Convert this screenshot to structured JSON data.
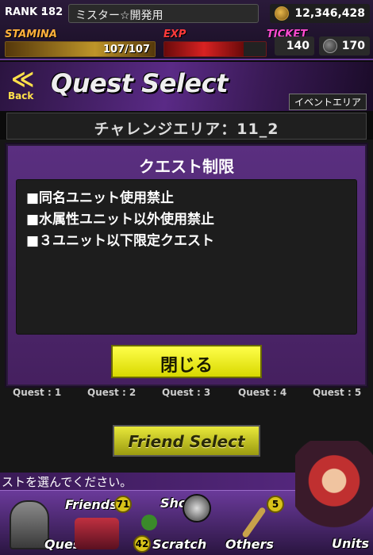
{
  "status": {
    "rank_label": "RANK :",
    "rank_value": "182",
    "player_name": "ミスター☆開発用",
    "gold": "12,346,428",
    "stamina_label": "STAMINA",
    "stamina_value": "107/107",
    "stamina_fraction": 1.0,
    "exp_label": "EXP",
    "exp_fraction": 0.78,
    "ticket_label": "TICKET",
    "ticket_value": "140",
    "gem_value": "170"
  },
  "header": {
    "back_label": "Back",
    "back_glyph": "≪",
    "title": "Quest Select",
    "event_tag": "イベントエリア"
  },
  "area": {
    "name": "チャレンジエリア：11_2"
  },
  "modal": {
    "title": "クエスト制限",
    "rules": [
      "■同名ユニット使用禁止",
      "■水属性ユニット以外使用禁止",
      "■３ユニット以下限定クエスト"
    ],
    "close_label": "閉じる"
  },
  "quest_tabs": [
    "Quest : 1",
    "Quest : 2",
    "Quest : 3",
    "Quest : 4",
    "Quest : 5"
  ],
  "friend_select_label": "Friend Select",
  "hint_text": "ストを選んでください。",
  "nav": {
    "quest": "Quest",
    "friends": "Friends",
    "friends_badge": "71",
    "shop": "Shop",
    "scratch": "Scratch",
    "scratch_badge": "42",
    "others": "Others",
    "others_badge": "5",
    "units": "Units"
  },
  "colors": {
    "accent_purple": "#5a2a86",
    "button_yellow": "#ffff4a",
    "stamina_orange": "#ffb13b",
    "exp_red": "#ff3a3a",
    "ticket_pink": "#ff4bd0"
  }
}
